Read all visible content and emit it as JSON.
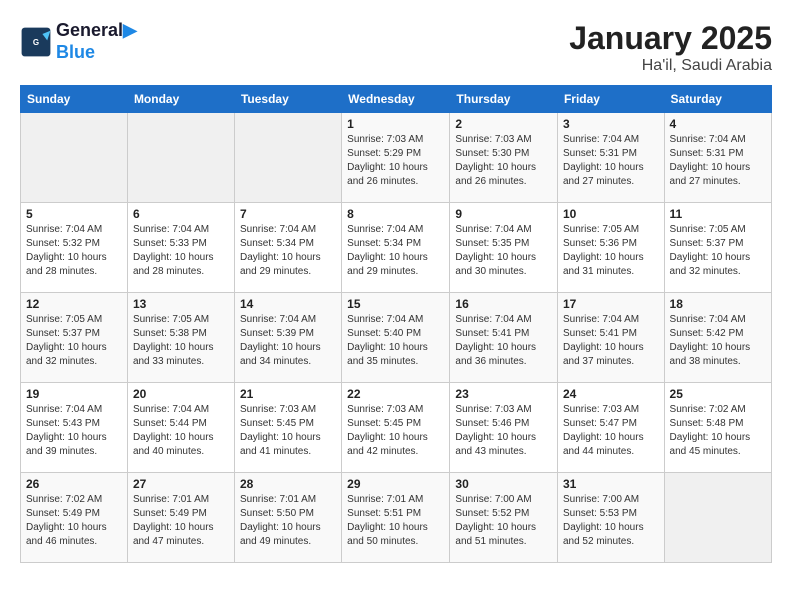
{
  "header": {
    "logo_line1": "General",
    "logo_line2": "Blue",
    "month_title": "January 2025",
    "subtitle": "Ha'il, Saudi Arabia"
  },
  "days_of_week": [
    "Sunday",
    "Monday",
    "Tuesday",
    "Wednesday",
    "Thursday",
    "Friday",
    "Saturday"
  ],
  "weeks": [
    [
      {
        "day": "",
        "info": ""
      },
      {
        "day": "",
        "info": ""
      },
      {
        "day": "",
        "info": ""
      },
      {
        "day": "1",
        "info": "Sunrise: 7:03 AM\nSunset: 5:29 PM\nDaylight: 10 hours and 26 minutes."
      },
      {
        "day": "2",
        "info": "Sunrise: 7:03 AM\nSunset: 5:30 PM\nDaylight: 10 hours and 26 minutes."
      },
      {
        "day": "3",
        "info": "Sunrise: 7:04 AM\nSunset: 5:31 PM\nDaylight: 10 hours and 27 minutes."
      },
      {
        "day": "4",
        "info": "Sunrise: 7:04 AM\nSunset: 5:31 PM\nDaylight: 10 hours and 27 minutes."
      }
    ],
    [
      {
        "day": "5",
        "info": "Sunrise: 7:04 AM\nSunset: 5:32 PM\nDaylight: 10 hours and 28 minutes."
      },
      {
        "day": "6",
        "info": "Sunrise: 7:04 AM\nSunset: 5:33 PM\nDaylight: 10 hours and 28 minutes."
      },
      {
        "day": "7",
        "info": "Sunrise: 7:04 AM\nSunset: 5:34 PM\nDaylight: 10 hours and 29 minutes."
      },
      {
        "day": "8",
        "info": "Sunrise: 7:04 AM\nSunset: 5:34 PM\nDaylight: 10 hours and 29 minutes."
      },
      {
        "day": "9",
        "info": "Sunrise: 7:04 AM\nSunset: 5:35 PM\nDaylight: 10 hours and 30 minutes."
      },
      {
        "day": "10",
        "info": "Sunrise: 7:05 AM\nSunset: 5:36 PM\nDaylight: 10 hours and 31 minutes."
      },
      {
        "day": "11",
        "info": "Sunrise: 7:05 AM\nSunset: 5:37 PM\nDaylight: 10 hours and 32 minutes."
      }
    ],
    [
      {
        "day": "12",
        "info": "Sunrise: 7:05 AM\nSunset: 5:37 PM\nDaylight: 10 hours and 32 minutes."
      },
      {
        "day": "13",
        "info": "Sunrise: 7:05 AM\nSunset: 5:38 PM\nDaylight: 10 hours and 33 minutes."
      },
      {
        "day": "14",
        "info": "Sunrise: 7:04 AM\nSunset: 5:39 PM\nDaylight: 10 hours and 34 minutes."
      },
      {
        "day": "15",
        "info": "Sunrise: 7:04 AM\nSunset: 5:40 PM\nDaylight: 10 hours and 35 minutes."
      },
      {
        "day": "16",
        "info": "Sunrise: 7:04 AM\nSunset: 5:41 PM\nDaylight: 10 hours and 36 minutes."
      },
      {
        "day": "17",
        "info": "Sunrise: 7:04 AM\nSunset: 5:41 PM\nDaylight: 10 hours and 37 minutes."
      },
      {
        "day": "18",
        "info": "Sunrise: 7:04 AM\nSunset: 5:42 PM\nDaylight: 10 hours and 38 minutes."
      }
    ],
    [
      {
        "day": "19",
        "info": "Sunrise: 7:04 AM\nSunset: 5:43 PM\nDaylight: 10 hours and 39 minutes."
      },
      {
        "day": "20",
        "info": "Sunrise: 7:04 AM\nSunset: 5:44 PM\nDaylight: 10 hours and 40 minutes."
      },
      {
        "day": "21",
        "info": "Sunrise: 7:03 AM\nSunset: 5:45 PM\nDaylight: 10 hours and 41 minutes."
      },
      {
        "day": "22",
        "info": "Sunrise: 7:03 AM\nSunset: 5:45 PM\nDaylight: 10 hours and 42 minutes."
      },
      {
        "day": "23",
        "info": "Sunrise: 7:03 AM\nSunset: 5:46 PM\nDaylight: 10 hours and 43 minutes."
      },
      {
        "day": "24",
        "info": "Sunrise: 7:03 AM\nSunset: 5:47 PM\nDaylight: 10 hours and 44 minutes."
      },
      {
        "day": "25",
        "info": "Sunrise: 7:02 AM\nSunset: 5:48 PM\nDaylight: 10 hours and 45 minutes."
      }
    ],
    [
      {
        "day": "26",
        "info": "Sunrise: 7:02 AM\nSunset: 5:49 PM\nDaylight: 10 hours and 46 minutes."
      },
      {
        "day": "27",
        "info": "Sunrise: 7:01 AM\nSunset: 5:49 PM\nDaylight: 10 hours and 47 minutes."
      },
      {
        "day": "28",
        "info": "Sunrise: 7:01 AM\nSunset: 5:50 PM\nDaylight: 10 hours and 49 minutes."
      },
      {
        "day": "29",
        "info": "Sunrise: 7:01 AM\nSunset: 5:51 PM\nDaylight: 10 hours and 50 minutes."
      },
      {
        "day": "30",
        "info": "Sunrise: 7:00 AM\nSunset: 5:52 PM\nDaylight: 10 hours and 51 minutes."
      },
      {
        "day": "31",
        "info": "Sunrise: 7:00 AM\nSunset: 5:53 PM\nDaylight: 10 hours and 52 minutes."
      },
      {
        "day": "",
        "info": ""
      }
    ]
  ]
}
